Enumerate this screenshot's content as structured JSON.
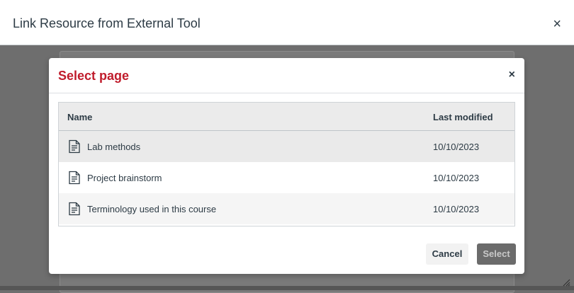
{
  "outer_modal": {
    "title": "Link Resource from External Tool",
    "close_glyph": "×"
  },
  "dialog": {
    "title": "Select page",
    "close_glyph": "×",
    "title_color": "#c01c2c"
  },
  "table": {
    "columns": [
      "Name",
      "Last modified"
    ],
    "rows": [
      {
        "name": "Lab methods",
        "last_modified": "10/10/2023",
        "icon": "document-icon"
      },
      {
        "name": "Project brainstorm",
        "last_modified": "10/10/2023",
        "icon": "document-icon"
      },
      {
        "name": "Terminology used in this course",
        "last_modified": "10/10/2023",
        "icon": "document-icon"
      }
    ]
  },
  "footer": {
    "cancel_label": "Cancel",
    "select_label": "Select"
  }
}
